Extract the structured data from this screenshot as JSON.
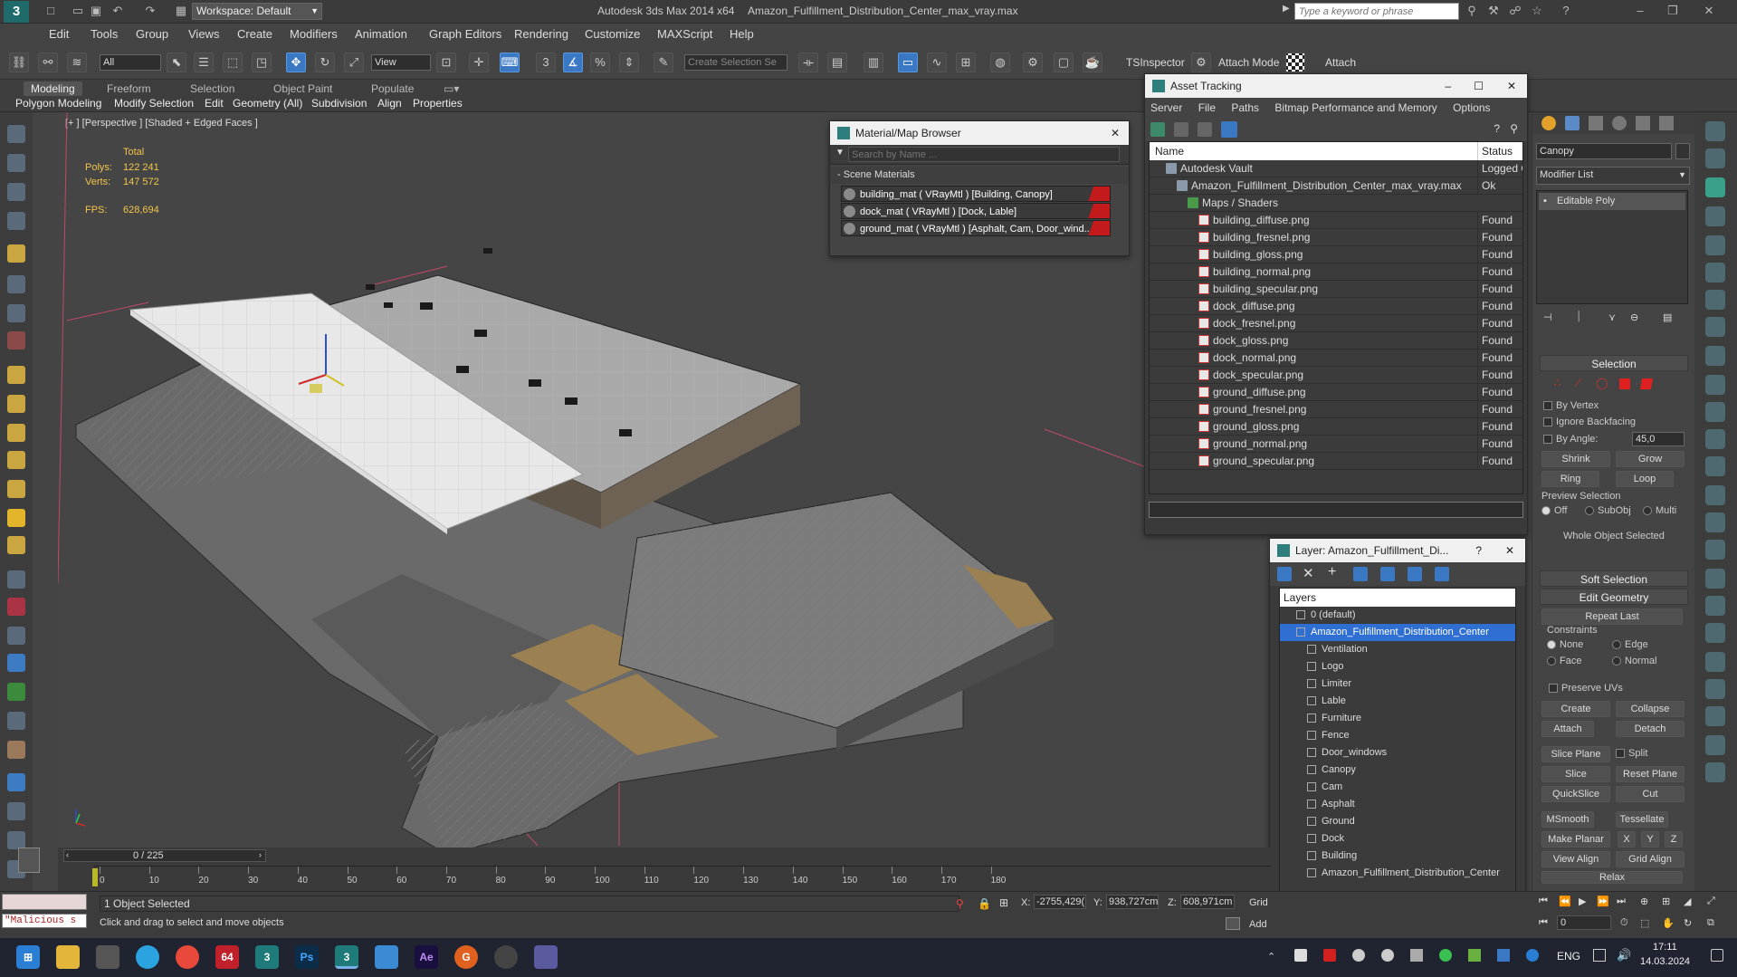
{
  "titlebar": {
    "workspace": "Workspace: Default",
    "app_title": "Autodesk 3ds Max 2014 x64",
    "file_title": "Amazon_Fulfillment_Distribution_Center_max_vray.max",
    "search_placeholder": "Type a keyword or phrase"
  },
  "menu": [
    "Edit",
    "Tools",
    "Group",
    "Views",
    "Create",
    "Modifiers",
    "Animation",
    "Graph Editors",
    "Rendering",
    "Customize",
    "MAXScript",
    "Help"
  ],
  "toolbar": {
    "filter_value": "All",
    "refcoord_value": "View",
    "selection_set_placeholder": "Create Selection Se",
    "tsinspector": "TSInspector",
    "attach_mode": "Attach Mode",
    "attach": "Attach"
  },
  "ribbon": {
    "tabs": [
      "Modeling",
      "Freeform",
      "Selection",
      "Object Paint",
      "Populate"
    ],
    "subtabs": [
      "Polygon Modeling",
      "Modify Selection",
      "Edit",
      "Geometry (All)",
      "Subdivision",
      "Align",
      "Properties"
    ]
  },
  "viewport": {
    "label": "[+ ] [Perspective ] [Shaded + Edged Faces ]",
    "stats_total": "Total",
    "polys_label": "Polys:",
    "polys_value": "122 241",
    "verts_label": "Verts:",
    "verts_value": "147 572",
    "fps_label": "FPS:",
    "fps_value": "628,694"
  },
  "material_browser": {
    "title": "Material/Map Browser",
    "search_placeholder": "Search by Name ...",
    "group": "- Scene Materials",
    "items": [
      "building_mat  ( VRayMtl )  [Building, Canopy]",
      "dock_mat  ( VRayMtl )  [Dock, Lable]",
      "ground_mat  ( VRayMtl )  [Asphalt, Cam, Door_wind..."
    ]
  },
  "asset_tracking": {
    "title": "Asset Tracking",
    "menu": [
      "Server",
      "File",
      "Paths",
      "Bitmap Performance and Memory",
      "Options"
    ],
    "col_name": "Name",
    "col_status": "Status",
    "rows": [
      {
        "name": "Autodesk Vault",
        "status": "Logged O",
        "indent": 1
      },
      {
        "name": "Amazon_Fulfillment_Distribution_Center_max_vray.max",
        "status": "Ok",
        "indent": 2
      },
      {
        "name": "Maps / Shaders",
        "status": "",
        "indent": 3
      },
      {
        "name": "building_diffuse.png",
        "status": "Found",
        "indent": 4
      },
      {
        "name": "building_fresnel.png",
        "status": "Found",
        "indent": 4
      },
      {
        "name": "building_gloss.png",
        "status": "Found",
        "indent": 4
      },
      {
        "name": "building_normal.png",
        "status": "Found",
        "indent": 4
      },
      {
        "name": "building_specular.png",
        "status": "Found",
        "indent": 4
      },
      {
        "name": "dock_diffuse.png",
        "status": "Found",
        "indent": 4
      },
      {
        "name": "dock_fresnel.png",
        "status": "Found",
        "indent": 4
      },
      {
        "name": "dock_gloss.png",
        "status": "Found",
        "indent": 4
      },
      {
        "name": "dock_normal.png",
        "status": "Found",
        "indent": 4
      },
      {
        "name": "dock_specular.png",
        "status": "Found",
        "indent": 4
      },
      {
        "name": "ground_diffuse.png",
        "status": "Found",
        "indent": 4
      },
      {
        "name": "ground_fresnel.png",
        "status": "Found",
        "indent": 4
      },
      {
        "name": "ground_gloss.png",
        "status": "Found",
        "indent": 4
      },
      {
        "name": "ground_normal.png",
        "status": "Found",
        "indent": 4
      },
      {
        "name": "ground_specular.png",
        "status": "Found",
        "indent": 4
      }
    ]
  },
  "layer_panel": {
    "title": "Layer: Amazon_Fulfillment_Di...",
    "header": "Layers",
    "items": [
      {
        "name": "0 (default)",
        "indent": 1,
        "selected": false
      },
      {
        "name": "Amazon_Fulfillment_Distribution_Center",
        "indent": 1,
        "selected": true
      },
      {
        "name": "Ventilation",
        "indent": 2,
        "selected": false
      },
      {
        "name": "Logo",
        "indent": 2,
        "selected": false
      },
      {
        "name": "Limiter",
        "indent": 2,
        "selected": false
      },
      {
        "name": "Lable",
        "indent": 2,
        "selected": false
      },
      {
        "name": "Furniture",
        "indent": 2,
        "selected": false
      },
      {
        "name": "Fence",
        "indent": 2,
        "selected": false
      },
      {
        "name": "Door_windows",
        "indent": 2,
        "selected": false
      },
      {
        "name": "Canopy",
        "indent": 2,
        "selected": false
      },
      {
        "name": "Cam",
        "indent": 2,
        "selected": false
      },
      {
        "name": "Asphalt",
        "indent": 2,
        "selected": false
      },
      {
        "name": "Ground",
        "indent": 2,
        "selected": false
      },
      {
        "name": "Dock",
        "indent": 2,
        "selected": false
      },
      {
        "name": "Building",
        "indent": 2,
        "selected": false
      },
      {
        "name": "Amazon_Fulfillment_Distribution_Center",
        "indent": 2,
        "selected": false
      }
    ]
  },
  "command_panel": {
    "object_name": "Canopy",
    "modifier_list": "Modifier List",
    "stack_item": "Editable Poly",
    "selection_title": "Selection",
    "by_vertex": "By Vertex",
    "ignore_backfacing": "Ignore Backfacing",
    "by_angle": "By Angle:",
    "by_angle_value": "45,0",
    "shrink": "Shrink",
    "grow": "Grow",
    "ring": "Ring",
    "loop": "Loop",
    "preview_selection": "Preview Selection",
    "preview_off": "Off",
    "preview_subobj": "SubObj",
    "preview_multi": "Multi",
    "whole_object": "Whole Object Selected",
    "soft_selection": "Soft Selection",
    "edit_geometry": "Edit Geometry",
    "repeat_last": "Repeat Last",
    "constraints": "Constraints",
    "c_none": "None",
    "c_edge": "Edge",
    "c_face": "Face",
    "c_normal": "Normal",
    "preserve_uvs": "Preserve UVs",
    "create": "Create",
    "collapse": "Collapse",
    "attach": "Attach",
    "detach": "Detach",
    "slice_plane": "Slice Plane",
    "split": "Split",
    "slice": "Slice",
    "reset_plane": "Reset Plane",
    "quickslice": "QuickSlice",
    "cut": "Cut",
    "msmooth": "MSmooth",
    "tessellate": "Tessellate",
    "make_planar": "Make Planar",
    "x": "X",
    "y": "Y",
    "z": "Z",
    "view_align": "View Align",
    "grid_align": "Grid Align",
    "relax": "Relax"
  },
  "timeline": {
    "frame_counter": "0 / 225",
    "ticks": [
      "0",
      "10",
      "20",
      "30",
      "40",
      "50",
      "60",
      "70",
      "80",
      "90",
      "100",
      "110",
      "120",
      "130",
      "140",
      "150",
      "160",
      "170",
      "180"
    ]
  },
  "status": {
    "maxscript": "\"Malicious s",
    "selected": "1 Object Selected",
    "prompt": "Click and drag to select and move objects",
    "x_label": "X:",
    "x_value": "-2755,429(",
    "y_label": "Y:",
    "y_value": "938,727cm",
    "z_label": "Z:",
    "z_value": "608,971cm",
    "grid": "Grid",
    "add": "Add",
    "frame": "0"
  },
  "taskbar": {
    "lang": "ENG",
    "time": "17:11",
    "date": "14.03.2024",
    "badge": "64"
  },
  "colors": {
    "accent": "#3a78c4",
    "selected_row": "#2f6fd1",
    "stats": "#f3c64b",
    "found": "#dddddd"
  }
}
